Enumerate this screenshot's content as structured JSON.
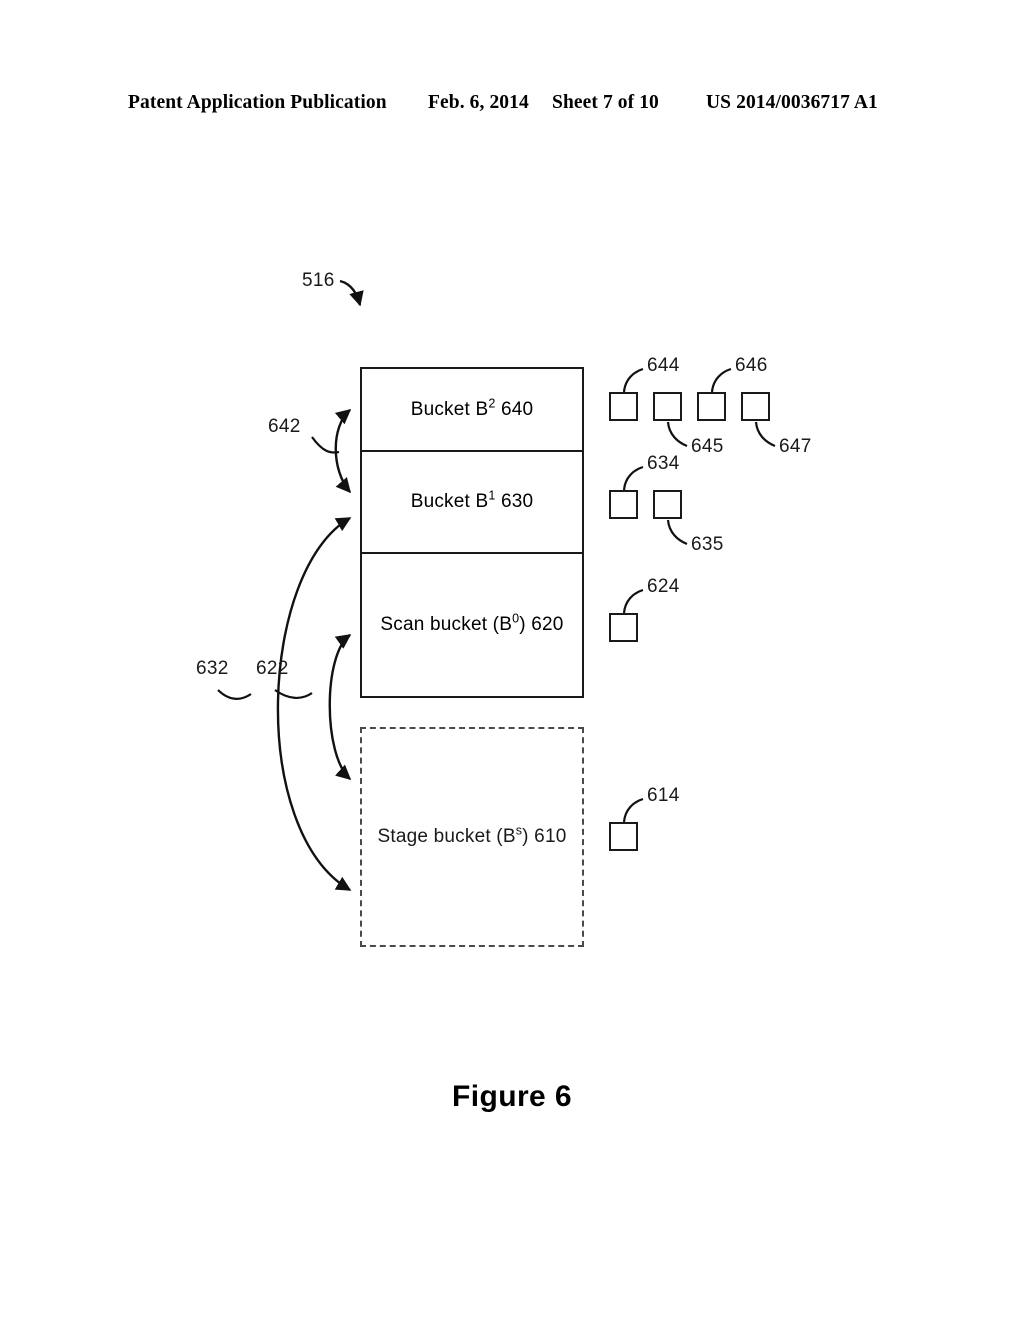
{
  "header": {
    "publication": "Patent Application Publication",
    "date": "Feb. 6, 2014",
    "sheet": "Sheet 7 of 10",
    "doc_number": "US 2014/0036717 A1"
  },
  "figure": {
    "caption": "Figure 6",
    "system_ref": "516"
  },
  "diagram": {
    "buckets": [
      {
        "id": "bucket-b2",
        "label_prefix": "Bucket B",
        "label_sup": "2",
        "label_suffix": " 640",
        "ref": "640",
        "style": "solid"
      },
      {
        "id": "bucket-b1",
        "label_prefix": "Bucket B",
        "label_sup": "1",
        "label_suffix": " 630",
        "ref": "630",
        "style": "solid"
      },
      {
        "id": "scan-bucket",
        "label_prefix": "Scan bucket (B",
        "label_sup": "0",
        "label_suffix": ") 620",
        "ref": "620",
        "style": "solid"
      },
      {
        "id": "stage-bucket",
        "label_prefix": "Stage bucket (B",
        "label_sup": "s",
        "label_suffix": ") 610",
        "ref": "610",
        "style": "dashed"
      }
    ],
    "element_squares": [
      {
        "id": "sq-644",
        "ref": "644",
        "row": "b2",
        "leader": "up"
      },
      {
        "id": "sq-645",
        "ref": "645",
        "row": "b2",
        "leader": "down"
      },
      {
        "id": "sq-646",
        "ref": "646",
        "row": "b2",
        "leader": "up"
      },
      {
        "id": "sq-647",
        "ref": "647",
        "row": "b2",
        "leader": "down"
      },
      {
        "id": "sq-634",
        "ref": "634",
        "row": "b1",
        "leader": "up"
      },
      {
        "id": "sq-635",
        "ref": "635",
        "row": "b1",
        "leader": "down"
      },
      {
        "id": "sq-624",
        "ref": "624",
        "row": "scan",
        "leader": "up"
      },
      {
        "id": "sq-614",
        "ref": "614",
        "row": "stage",
        "leader": "up"
      }
    ],
    "flow_arrows": [
      {
        "id": "arrow-642",
        "ref": "642",
        "kind": "double-headed"
      },
      {
        "id": "arrow-632",
        "ref": "632",
        "kind": "double-headed"
      },
      {
        "id": "arrow-622",
        "ref": "622",
        "kind": "double-headed"
      }
    ],
    "refs": {
      "r516": "516",
      "r642": "642",
      "r632": "632",
      "r622": "622",
      "r644": "644",
      "r645": "645",
      "r646": "646",
      "r647": "647",
      "r634": "634",
      "r635": "635",
      "r624": "624",
      "r614": "614"
    },
    "colors": {
      "ink": "#1a1a1a",
      "dashed_ink": "#4a4a4a",
      "paper": "#ffffff"
    }
  }
}
